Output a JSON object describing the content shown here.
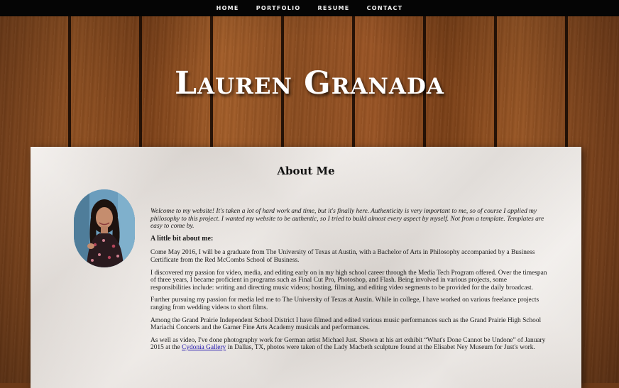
{
  "nav": {
    "items": [
      "HOME",
      "PORTFOLIO",
      "RESUME",
      "CONTACT"
    ]
  },
  "site_title": "Lauren Granada",
  "about": {
    "heading": "About Me",
    "intro": "Welcome to my website! It's taken a lot of hard work and time, but it's finally here. Authenticity is very important to me, so of course I applied my philosophy to this project. I wanted my website to be authentic, so I tried to build almost every aspect by myself. Not from a template. Templates are easy to come by.",
    "subheading": "A little bit about me:",
    "p1": "Come May 2016, I will be a graduate from The University of Texas at Austin, with a Bachelor of Arts in Philosophy accompanied by a Business Certificate from the Red McCombs School of Business.",
    "p2": "I discovered my passion for video, media, and editing early on in my high school career through the Media Tech Program offered. Over the timespan of three years, I became proficient in programs such as Final Cut Pro, Photoshop, and Flash. Being involved in various projects, some responsibilities include: writing and directing music videos; hosting, filming, and editing video segments to be provided for the daily broadcast.",
    "p3": "Further pursuing my passion for media led me to The University of Texas at Austin. While in college, I have worked on various freelance projects ranging from wedding videos to short films.",
    "p4": "Among the Grand Prairie Independent School District I have filmed and edited various music performances such as the Grand Prairie High School Mariachi Concerts and the Garner Fine Arts Academy musicals and performances.",
    "p5_before": "As well as video, I've done photography work for German artist Michael Just. Shown at his art exhibit “What's Done Cannot be Undone” of January 2015 at the ",
    "p5_link": "Cydonia Gallery",
    "p5_after": " in Dallas, TX, photos were taken of the Lady Macbeth sculpture found at the Elisabet Ney Museum for Just's work."
  },
  "icons": {
    "avatar": "profile-photo"
  },
  "colors": {
    "nav_bg": "#050505",
    "paper": "#e9e3de",
    "link": "#1a0dab",
    "wood": "#8a4a1e"
  }
}
